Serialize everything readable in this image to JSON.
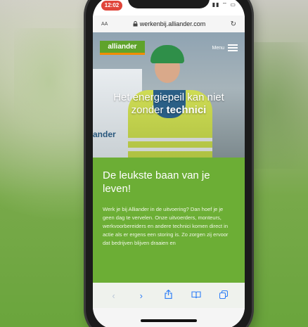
{
  "status": {
    "time": "12:02",
    "icons": "▮▮ ⌔ ▭"
  },
  "browser": {
    "aa_label": "AA",
    "lock_icon": "lock-icon",
    "url": "werkenbij.alliander.com",
    "reload_icon": "reload-icon"
  },
  "site": {
    "logo": "alliander",
    "menu_label": "Menu",
    "hero_prefix": "Het energiepeil kan niet zonder",
    "hero_bold": "technici",
    "van_text": "ander",
    "heading": "De leukste baan van je leven!",
    "body": "Werk je bij Alliander in de uitvoering? Dan hoef je je geen dag te vervelen. Onze uitvoerders, monteurs, werkvoorbereiders en andere technici komen direct in actie als er ergens een storing is. Zo zorgen zij ervoor dat bedrijven blijven draaien en"
  },
  "toolbar": {
    "back_icon": "chevron-left-icon",
    "forward_icon": "chevron-right-icon",
    "share_icon": "share-icon",
    "bookmarks_icon": "book-icon",
    "tabs_icon": "tabs-icon"
  },
  "colors": {
    "brand_green": "#6cae35",
    "brand_orange": "#f28c00",
    "ios_blue": "#2f7ff6"
  }
}
